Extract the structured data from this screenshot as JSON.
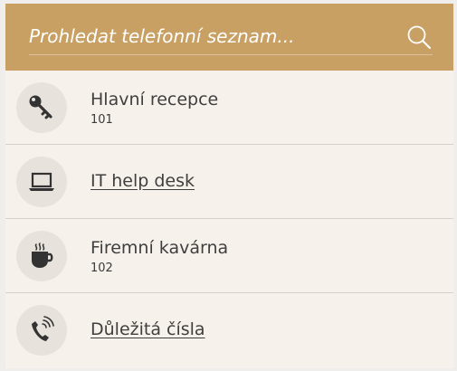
{
  "search": {
    "placeholder": "Prohledat telefonní seznam..."
  },
  "colors": {
    "header": "#c9a063",
    "panel": "#f7f1eb",
    "icon_circle": "#e7e2dc",
    "text": "#3f3f3f"
  },
  "items": [
    {
      "icon": "key-icon",
      "title": "Hlavní recepce",
      "number": "101"
    },
    {
      "icon": "laptop-icon",
      "link": "IT help desk"
    },
    {
      "icon": "coffee-cup-icon",
      "title": "Firemní kavárna",
      "number": "102"
    },
    {
      "icon": "phone-ringing-icon",
      "link": "Důležitá čísla"
    }
  ]
}
